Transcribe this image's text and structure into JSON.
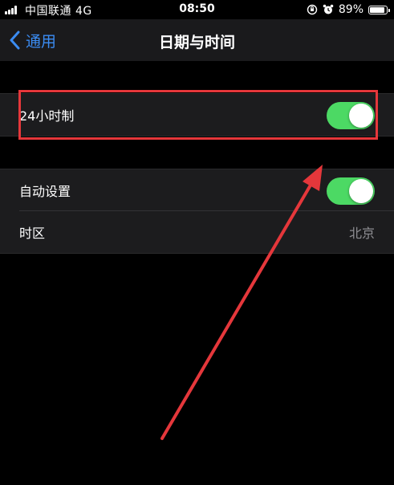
{
  "status_bar": {
    "carrier": "中国联通 4G",
    "time": "08:50",
    "battery_percent": "89%",
    "battery_level": 0.89
  },
  "nav": {
    "back_label": "通用",
    "title": "日期与时间"
  },
  "settings": {
    "hour24": {
      "label": "24小时制",
      "on": true
    },
    "auto_set": {
      "label": "自动设置",
      "on": true
    },
    "timezone": {
      "label": "时区",
      "value": "北京"
    }
  },
  "colors": {
    "toggle_on": "#4cd964",
    "accent": "#3b8cf2",
    "annotation": "#e5373b"
  },
  "icons": [
    "signal-icon",
    "orientation-lock-icon",
    "alarm-icon",
    "battery-icon",
    "chevron-left-icon"
  ]
}
